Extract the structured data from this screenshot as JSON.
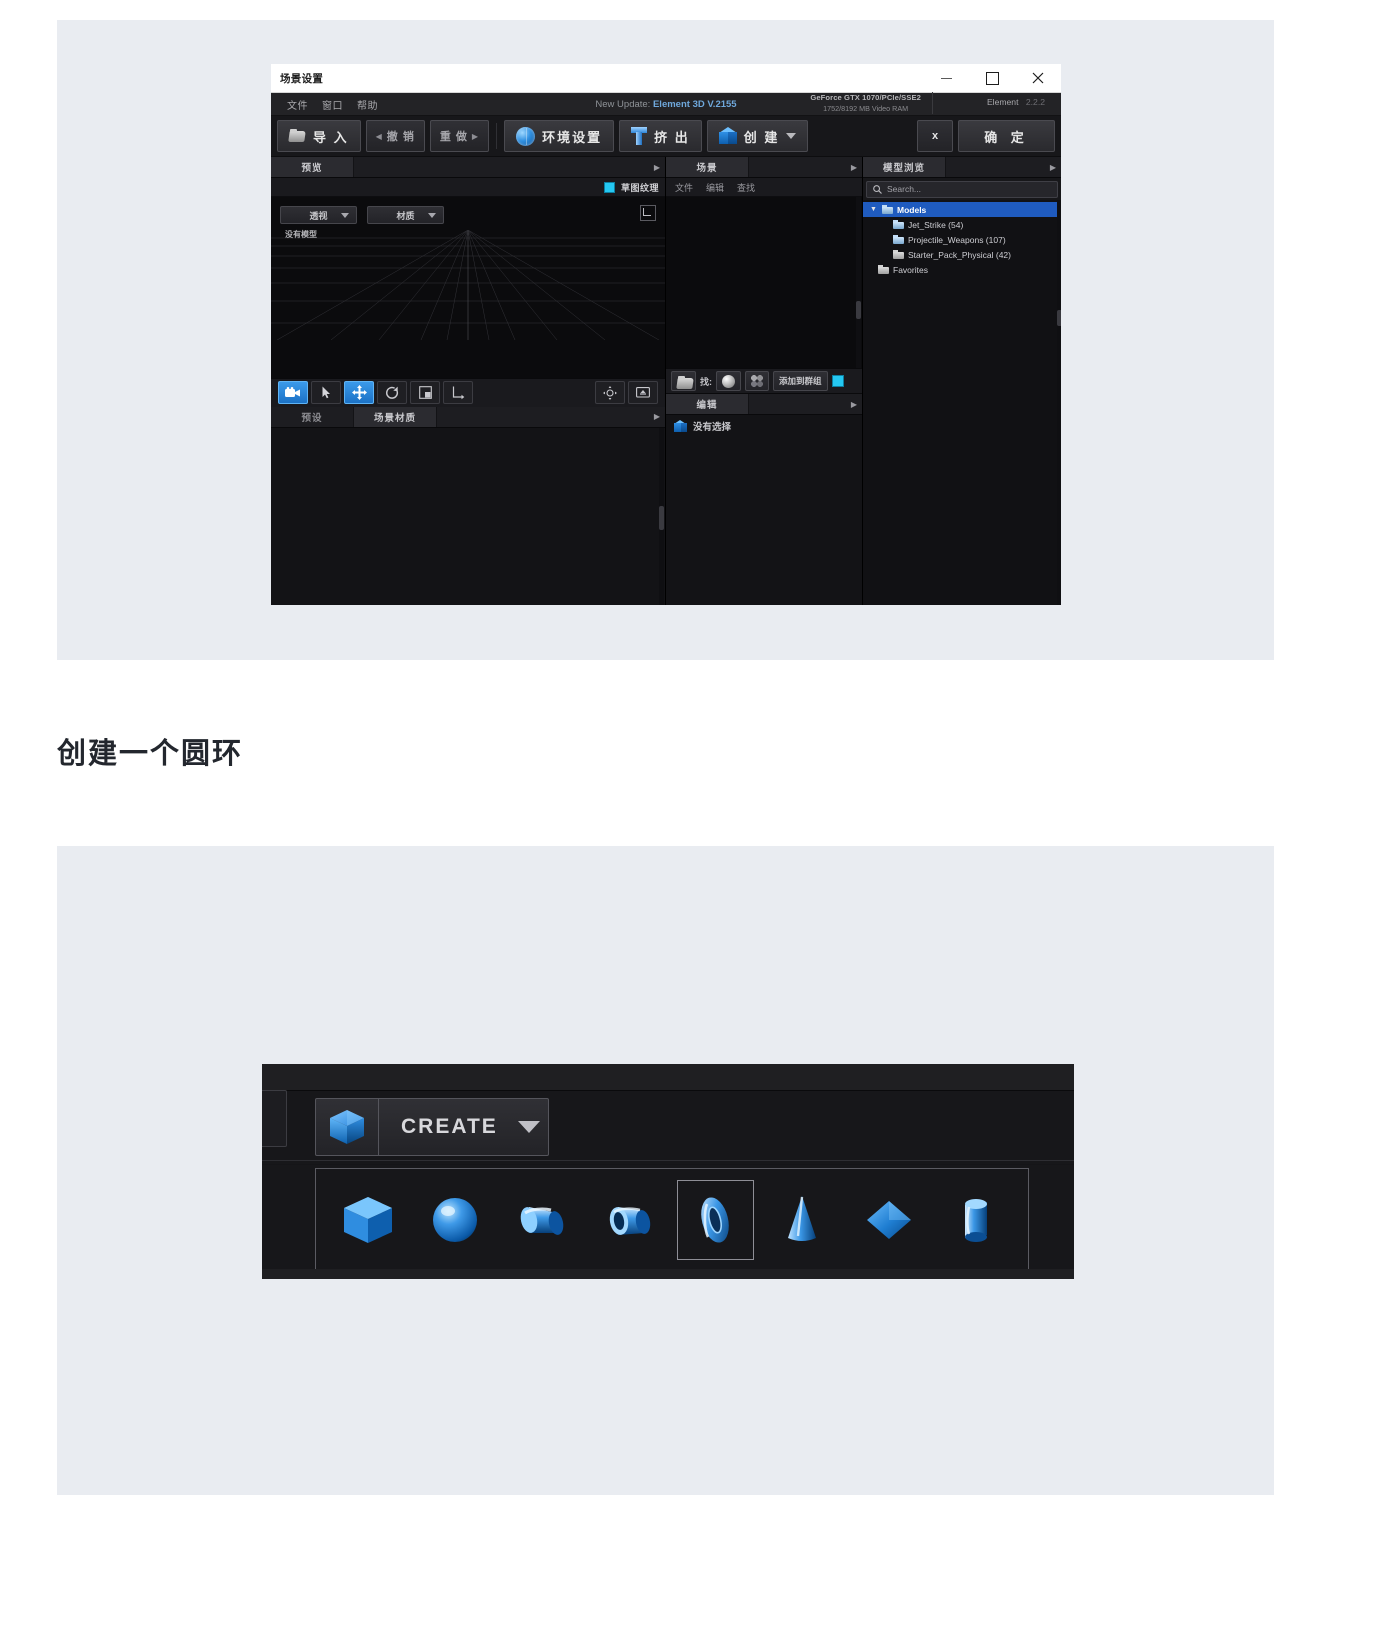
{
  "caption": "创建一个圆环",
  "window": {
    "title": "场景设置",
    "controls": {
      "minimize": "minimize-icon",
      "maximize": "maximize-icon",
      "close": "close-icon"
    },
    "menu": [
      "文件",
      "窗口",
      "帮助"
    ],
    "update_prefix": "New Update:",
    "update_version": "Element 3D V.2155",
    "gpu_line1": "GeForce GTX 1070/PCIe/SSE2",
    "gpu_line2": "1752/8192 MB Video RAM",
    "product_name": "Element",
    "product_version": "2.2.2"
  },
  "toolbar": {
    "import": "导 入",
    "undo": "撤 销",
    "redo": "重 做",
    "environment": "环境设置",
    "extrude": "挤 出",
    "create": "创 建",
    "close_x": "x",
    "confirm": "确 定"
  },
  "preview_panel": {
    "tab": "预览",
    "sketch_texture": "草图纹理",
    "view_mode": "透视",
    "material": "材质",
    "no_model": "没有模型",
    "tools": [
      {
        "name": "camera-tool",
        "active": true
      },
      {
        "name": "select-tool",
        "active": false
      },
      {
        "name": "move-tool",
        "active": true
      },
      {
        "name": "rotate-tool",
        "active": false
      },
      {
        "name": "scale-tool",
        "active": false
      },
      {
        "name": "axis-tool",
        "active": false
      },
      {
        "name": "center-view-tool",
        "active": false
      },
      {
        "name": "fit-view-tool",
        "active": false
      }
    ]
  },
  "presets_panel": {
    "tab_presets": "预设",
    "tab_scene_materials": "场景材质"
  },
  "scene_panel": {
    "tab": "场景",
    "menu": [
      "文件",
      "编辑",
      "查找"
    ],
    "bar_label": "找:",
    "add_to_group": "添加到群组",
    "edit_tab": "编辑",
    "no_selection": "没有选择"
  },
  "model_browser": {
    "tab": "模型浏览",
    "search_placeholder": "Search...",
    "tree": [
      {
        "label": "Models",
        "level": 0,
        "selected": true,
        "expanded": true,
        "folder": "blue"
      },
      {
        "label": "Jet_Strike (54)",
        "level": 1,
        "selected": false,
        "folder": "blue"
      },
      {
        "label": "Projectile_Weapons (107)",
        "level": 1,
        "selected": false,
        "folder": "blue"
      },
      {
        "label": "Starter_Pack_Physical (42)",
        "level": 1,
        "selected": false,
        "folder": "grey"
      },
      {
        "label": "Favorites",
        "level": 0,
        "selected": false,
        "folder": "grey"
      }
    ]
  },
  "create_palette": {
    "button_label": "CREATE",
    "button_icon": "cube-icon",
    "shapes": [
      {
        "name": "box-shape",
        "selected": false
      },
      {
        "name": "sphere-shape",
        "selected": false
      },
      {
        "name": "cylinder-shape",
        "selected": false
      },
      {
        "name": "tube-shape",
        "selected": false
      },
      {
        "name": "torus-shape",
        "selected": true
      },
      {
        "name": "cone-shape",
        "selected": false
      },
      {
        "name": "plane-shape",
        "selected": false
      },
      {
        "name": "capsule-shape",
        "selected": false
      }
    ]
  },
  "colors": {
    "accent_blue": "#1f5bbf",
    "cyan_check": "#25c8f2",
    "link_blue": "#6fa8dc",
    "panel_bg": "#17171a",
    "figure_bg": "#e9ecf1"
  }
}
